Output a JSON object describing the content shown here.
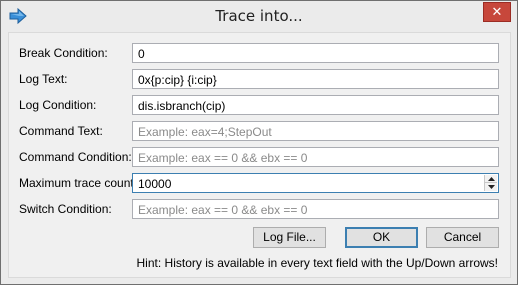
{
  "window": {
    "title": "Trace into...",
    "close_glyph": "✕",
    "app_icon": "arrow-into-icon"
  },
  "fields": {
    "break_condition": {
      "label": "Break Condition:",
      "value": "0"
    },
    "log_text": {
      "label": "Log Text:",
      "value": "0x{p:cip} {i:cip}"
    },
    "log_condition": {
      "label": "Log Condition:",
      "value": "dis.isbranch(cip)"
    },
    "command_text": {
      "label": "Command Text:",
      "placeholder": "Example: eax=4;StepOut"
    },
    "command_condition": {
      "label": "Command Condition:",
      "placeholder": "Example: eax == 0 && ebx == 0"
    },
    "max_trace_count": {
      "label": "Maximum trace count:",
      "value": "10000"
    },
    "switch_condition": {
      "label": "Switch Condition:",
      "placeholder": "Example: eax == 0 && ebx == 0"
    }
  },
  "buttons": {
    "log_file": "Log File...",
    "ok": "OK",
    "cancel": "Cancel"
  },
  "hint": "Hint: History is available in every text field with the Up/Down arrows!",
  "colors": {
    "close_button": "#c7473b",
    "focus_border": "#3c7fb1"
  }
}
